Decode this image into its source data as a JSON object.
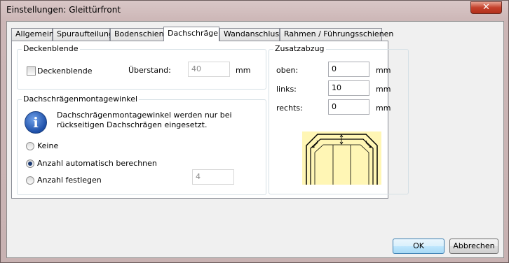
{
  "window": {
    "title": "Einstellungen: Gleittürfront",
    "close_glyph": "✕"
  },
  "tabs": [
    "Allgemein",
    "Spuraufteilung",
    "Bodenschiene",
    "Dachschräge",
    "Wandanschluss",
    "Rahmen / Führungsschienen"
  ],
  "active_tab": "Dachschräge",
  "deckenblende": {
    "group_label": "Deckenblende",
    "checkbox_label": "Deckenblende",
    "checked": false,
    "ueberstand_label": "Überstand:",
    "ueberstand_value": "40",
    "unit": "mm"
  },
  "montagewinkel": {
    "group_label": "Dachschrägenmontagewinkel",
    "info_line1": "Dachschrägenmontagewinkel werden nur bei",
    "info_line2": "rückseitigen Dachschrägen eingesetzt.",
    "options": [
      "Keine",
      "Anzahl automatisch berechnen",
      "Anzahl festlegen"
    ],
    "selected": "Anzahl automatisch berechnen",
    "anzahl_value": "4"
  },
  "zusatzabzug": {
    "group_label": "Zusatzabzug",
    "oben_label": "oben:",
    "oben_value": "0",
    "links_label": "links:",
    "links_value": "10",
    "rechts_label": "rechts:",
    "rechts_value": "0",
    "unit": "mm"
  },
  "buttons": {
    "ok": "OK",
    "cancel": "Abbrechen"
  },
  "colors": {
    "diagram_bg": "#fff6b5",
    "accent": "#3c7fb1"
  }
}
